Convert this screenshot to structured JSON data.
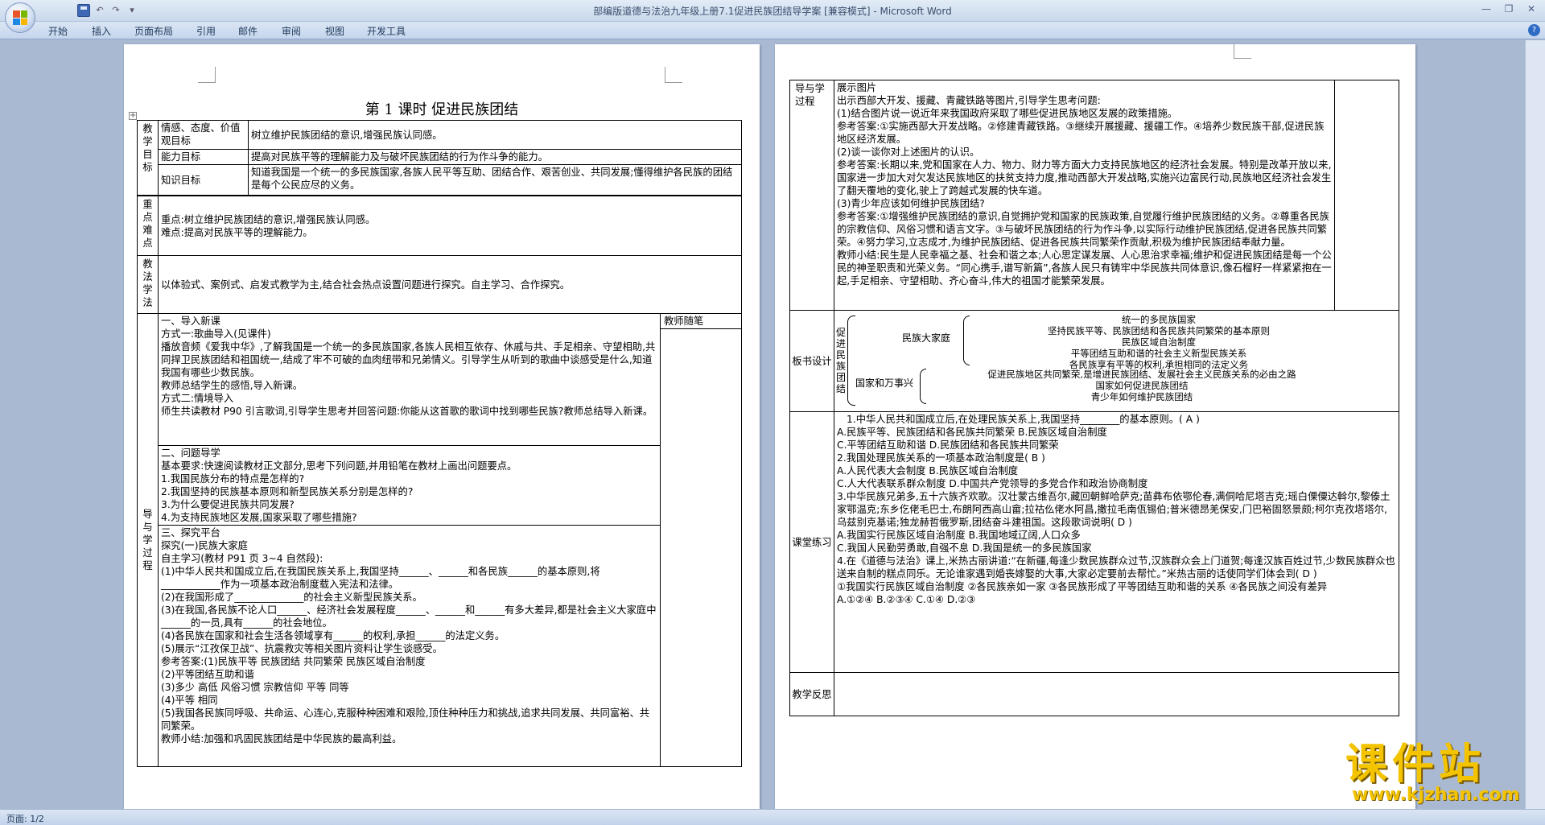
{
  "window": {
    "title": "部编版道德与法治九年级上册7.1促进民族团结导学案 [兼容模式] - Microsoft Word",
    "controls": [
      "—",
      "❐",
      "✕"
    ]
  },
  "qat": {
    "undo": "↶",
    "redo": "↷",
    "more": "▾"
  },
  "ribbon": {
    "tabs": [
      "开始",
      "插入",
      "页面布局",
      "引用",
      "邮件",
      "审阅",
      "视图",
      "开发工具"
    ]
  },
  "status": {
    "page": "页面: 1/2"
  },
  "watermark": {
    "main": "课件站",
    "url": "www.kjzhan.com"
  },
  "page1": {
    "title": "第 1 课时   促进民族团结",
    "goals_label": "教学目标",
    "goal_rows": [
      {
        "label": "情感、态度、价值观目标",
        "text": "树立维护民族团结的意识,增强民族认同感。"
      },
      {
        "label": "能力目标",
        "text": "提高对民族平等的理解能力及与破坏民族团结的行为作斗争的能力。"
      },
      {
        "label": "知识目标",
        "text": "知道我国是一个统一的多民族国家,各族人民平等互助、团结合作、艰苦创业、共同发展;懂得维护各民族的团结是每个公民应尽的义务。"
      }
    ],
    "keypoints_label": "重点难点",
    "keypoints": [
      "重点:树立维护民族团结的意识,增强民族认同感。",
      "难点:提高对民族平等的理解能力。"
    ],
    "method_label": "教法学法",
    "method": "以体验式、案例式、启发式教学为主,结合社会热点设置问题进行探究。自主学习、合作探究。",
    "process_label": "导与学过程",
    "notes_header": "教师随笔",
    "section1": [
      "一、导入新课",
      "方式一:歌曲导入(见课件)",
      "播放音频《爱我中华》,了解我国是一个统一的多民族国家,各族人民相互依存、休戚与共、手足相亲、守望相助,共同捍卫民族团结和祖国统一,结成了牢不可破的血肉纽带和兄弟情义。引导学生从听到的歌曲中谈感受是什么,知道我国有哪些少数民族。",
      "教师总结学生的感悟,导入新课。",
      "方式二:情境导入",
      "师生共读教材 P90 引言歌词,引导学生思考并回答问题:你能从这首歌的歌词中找到哪些民族?教师总结导入新课。"
    ],
    "section2": [
      "二、问题导学",
      "基本要求:快速阅读教材正文部分,思考下列问题,并用铅笔在教材上画出问题要点。",
      "1.我国民族分布的特点是怎样的?",
      "2.我国坚持的民族基本原则和新型民族关系分别是怎样的?",
      "3.为什么要促进民族共同发展?",
      "4.为支持民族地区发展,国家采取了哪些措施?"
    ],
    "section3": [
      "三、探究平台",
      "探究(一)民族大家庭",
      "  自主学习(教材 P91 页 3~4 自然段):",
      "(1)中华人民共和国成立后,在我国民族关系上,我国坚持______、______和各民族______的基本原则,将____________作为一项基本政治制度载入宪法和法律。",
      "(2)在我国形成了______________的社会主义新型民族关系。",
      "(3)在我国,各民族不论人口______、经济社会发展程度______、______和______有多大差异,都是社会主义大家庭中______的一员,具有______的社会地位。",
      "(4)各民族在国家和社会生活各领域享有______的权利,承担______的法定义务。",
      "(5)展示“江孜保卫战”、抗震救灾等相关图片资料让学生谈感受。",
      "参考答案:(1)民族平等  民族团结  共同繁荣  民族区域自治制度",
      "(2)平等团结互助和谐",
      "(3)多少  高低  风俗习惯  宗教信仰  平等  同等",
      "(4)平等  相同",
      "(5)我国各民族同呼吸、共命运、心连心,克服种种困难和艰险,顶住种种压力和挑战,追求共同发展、共同富裕、共同繁荣。",
      "教师小结:加强和巩固民族团结是中华民族的最高利益。"
    ]
  },
  "page2": {
    "process_label": "导与学过程",
    "process": [
      "展示图片",
      "出示西部大开发、援藏、青藏铁路等图片,引导学生思考问题:",
      "(1)结合图片说一说近年来我国政府采取了哪些促进民族地区发展的政策措施。",
      "参考答案:①实施西部大开发战略。②修建青藏铁路。③继续开展援藏、援疆工作。④培养少数民族干部,促进民族地区经济发展。",
      "(2)谈一谈你对上述图片的认识。",
      "参考答案:长期以来,党和国家在人力、物力、财力等方面大力支持民族地区的经济社会发展。特别是改革开放以来,国家进一步加大对欠发达民族地区的扶贫支持力度,推动西部大开发战略,实施兴边富民行动,民族地区经济社会发生了翻天覆地的变化,驶上了跨越式发展的快车道。",
      "(3)青少年应该如何维护民族团结?",
      "参考答案:①增强维护民族团结的意识,自觉拥护党和国家的民族政策,自觉履行维护民族团结的义务。②尊重各民族的宗教信仰、风俗习惯和语言文字。③与破坏民族团结的行为作斗争,以实际行动维护民族团结,促进各民族共同繁荣。④努力学习,立志成才,为维护民族团结、促进各民族共同繁荣作贡献,积极为维护民族团结奉献力量。",
      "教师小结:民生是人民幸福之基、社会和谐之本;人心思定谋发展、人心思治求幸福;维护和促进民族团结是每一个公民的神圣职责和光荣义务。“同心携手,谱写新篇”,各族人民只有铸牢中华民族共同体意识,像石榴籽一样紧紧抱在一起,手足相亲、守望相助、齐心奋斗,伟大的祖国才能繁荣发展。"
    ],
    "board_label": "板书设计",
    "board": {
      "root": "促进民族团结",
      "branch1": "民族大家庭",
      "branch1_items": [
        "统一的多民族国家",
        "坚持民族平等、民族团结和各民族共同繁荣的基本原则",
        "民族区域自治制度",
        "平等团结互助和谐的社会主义新型民族关系",
        "各民族享有平等的权利,承担相同的法定义务"
      ],
      "branch2": "国家和万事兴",
      "branch2_items": [
        "促进民族地区共同繁荣,是增进民族团结、发展社会主义民族关系的必由之路",
        "国家如何促进民族团结",
        "青少年如何维护民族团结"
      ]
    },
    "practice_label": "课堂练习",
    "practice": [
      "1.中华人民共和国成立后,在处理民族关系上,我国坚持________的基本原则。( A )",
      "A.民族平等、民族团结和各民族共同繁荣      B.民族区域自治制度",
      "C.平等团结互助和谐   D.民族团结和各民族共同繁荣",
      "2.我国处理民族关系的一项基本政治制度是( B )",
      "A.人民代表大会制度  B.民族区域自治制度",
      "C.人大代表联系群众制度   D.中国共产党领导的多党合作和政治协商制度",
      "3.中华民族兄弟多,五十六族齐欢歌。汉壮蒙古维吾尔,藏回朝鲜哈萨克;苗彝布依鄂伦春,满侗哈尼塔吉克;瑶白傈僳达斡尔,黎傣土家鄂温克;东乡仡佬毛巴士,布朗阿西高山畲;拉祜仫佬水阿昌,撒拉毛南佤锡伯;普米德昂羌保安,门巴裕固怒景颇;柯尔克孜塔塔尔,乌兹别克基诺;独龙赫哲俄罗斯,团结奋斗建祖国。这段歌词说明( D )",
      "A.我国实行民族区域自治制度  B.我国地域辽阔,人口众多",
      "C.我国人民勤劳勇敢,自强不息  D.我国是统一的多民族国家",
      "4.在《道德与法治》课上,米热古丽讲道:“在新疆,每逢少数民族群众过节,汉族群众会上门道贺;每逢汉族百姓过节,少数民族群众也送来自制的糕点同乐。无论谁家遇到婚丧嫁娶的大事,大家必定要前去帮忙。”米热古丽的话使同学们体会到( D )",
      "①我国实行民族区域自治制度  ②各民族亲如一家  ③各民族形成了平等团结互助和谐的关系  ④各民族之间没有差异",
      "A.①②④     B.②③④     C.①④   D.②③"
    ],
    "reflect_label": "教学反思"
  }
}
